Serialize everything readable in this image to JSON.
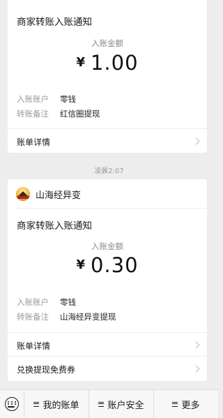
{
  "card1": {
    "title": "商家转账入账通知",
    "amount_label": "入账金额",
    "currency": "¥",
    "amount": "1.00",
    "rows": [
      {
        "label": "入账账户",
        "value": "零钱"
      },
      {
        "label": "转账备注",
        "value": "红信圈提现"
      }
    ],
    "link": "账单详情"
  },
  "timestamp": "凌晨2:07",
  "card2": {
    "sender_name": "山海经异变",
    "title": "商家转账入账通知",
    "amount_label": "入账金额",
    "currency": "¥",
    "amount": "0.30",
    "rows": [
      {
        "label": "入账账户",
        "value": "零钱"
      },
      {
        "label": "转账备注",
        "value": "山海经异变提现"
      }
    ],
    "links": [
      "账单详情",
      "兑换提现免费券"
    ]
  },
  "bottom_menu": [
    "我的账单",
    "账户安全",
    "更多"
  ],
  "icons": {
    "keyboard": "keyboard-icon",
    "menu": "menu-list-icon",
    "chevron": "chevron-right-icon",
    "logo": "shanhaijing-logo"
  }
}
